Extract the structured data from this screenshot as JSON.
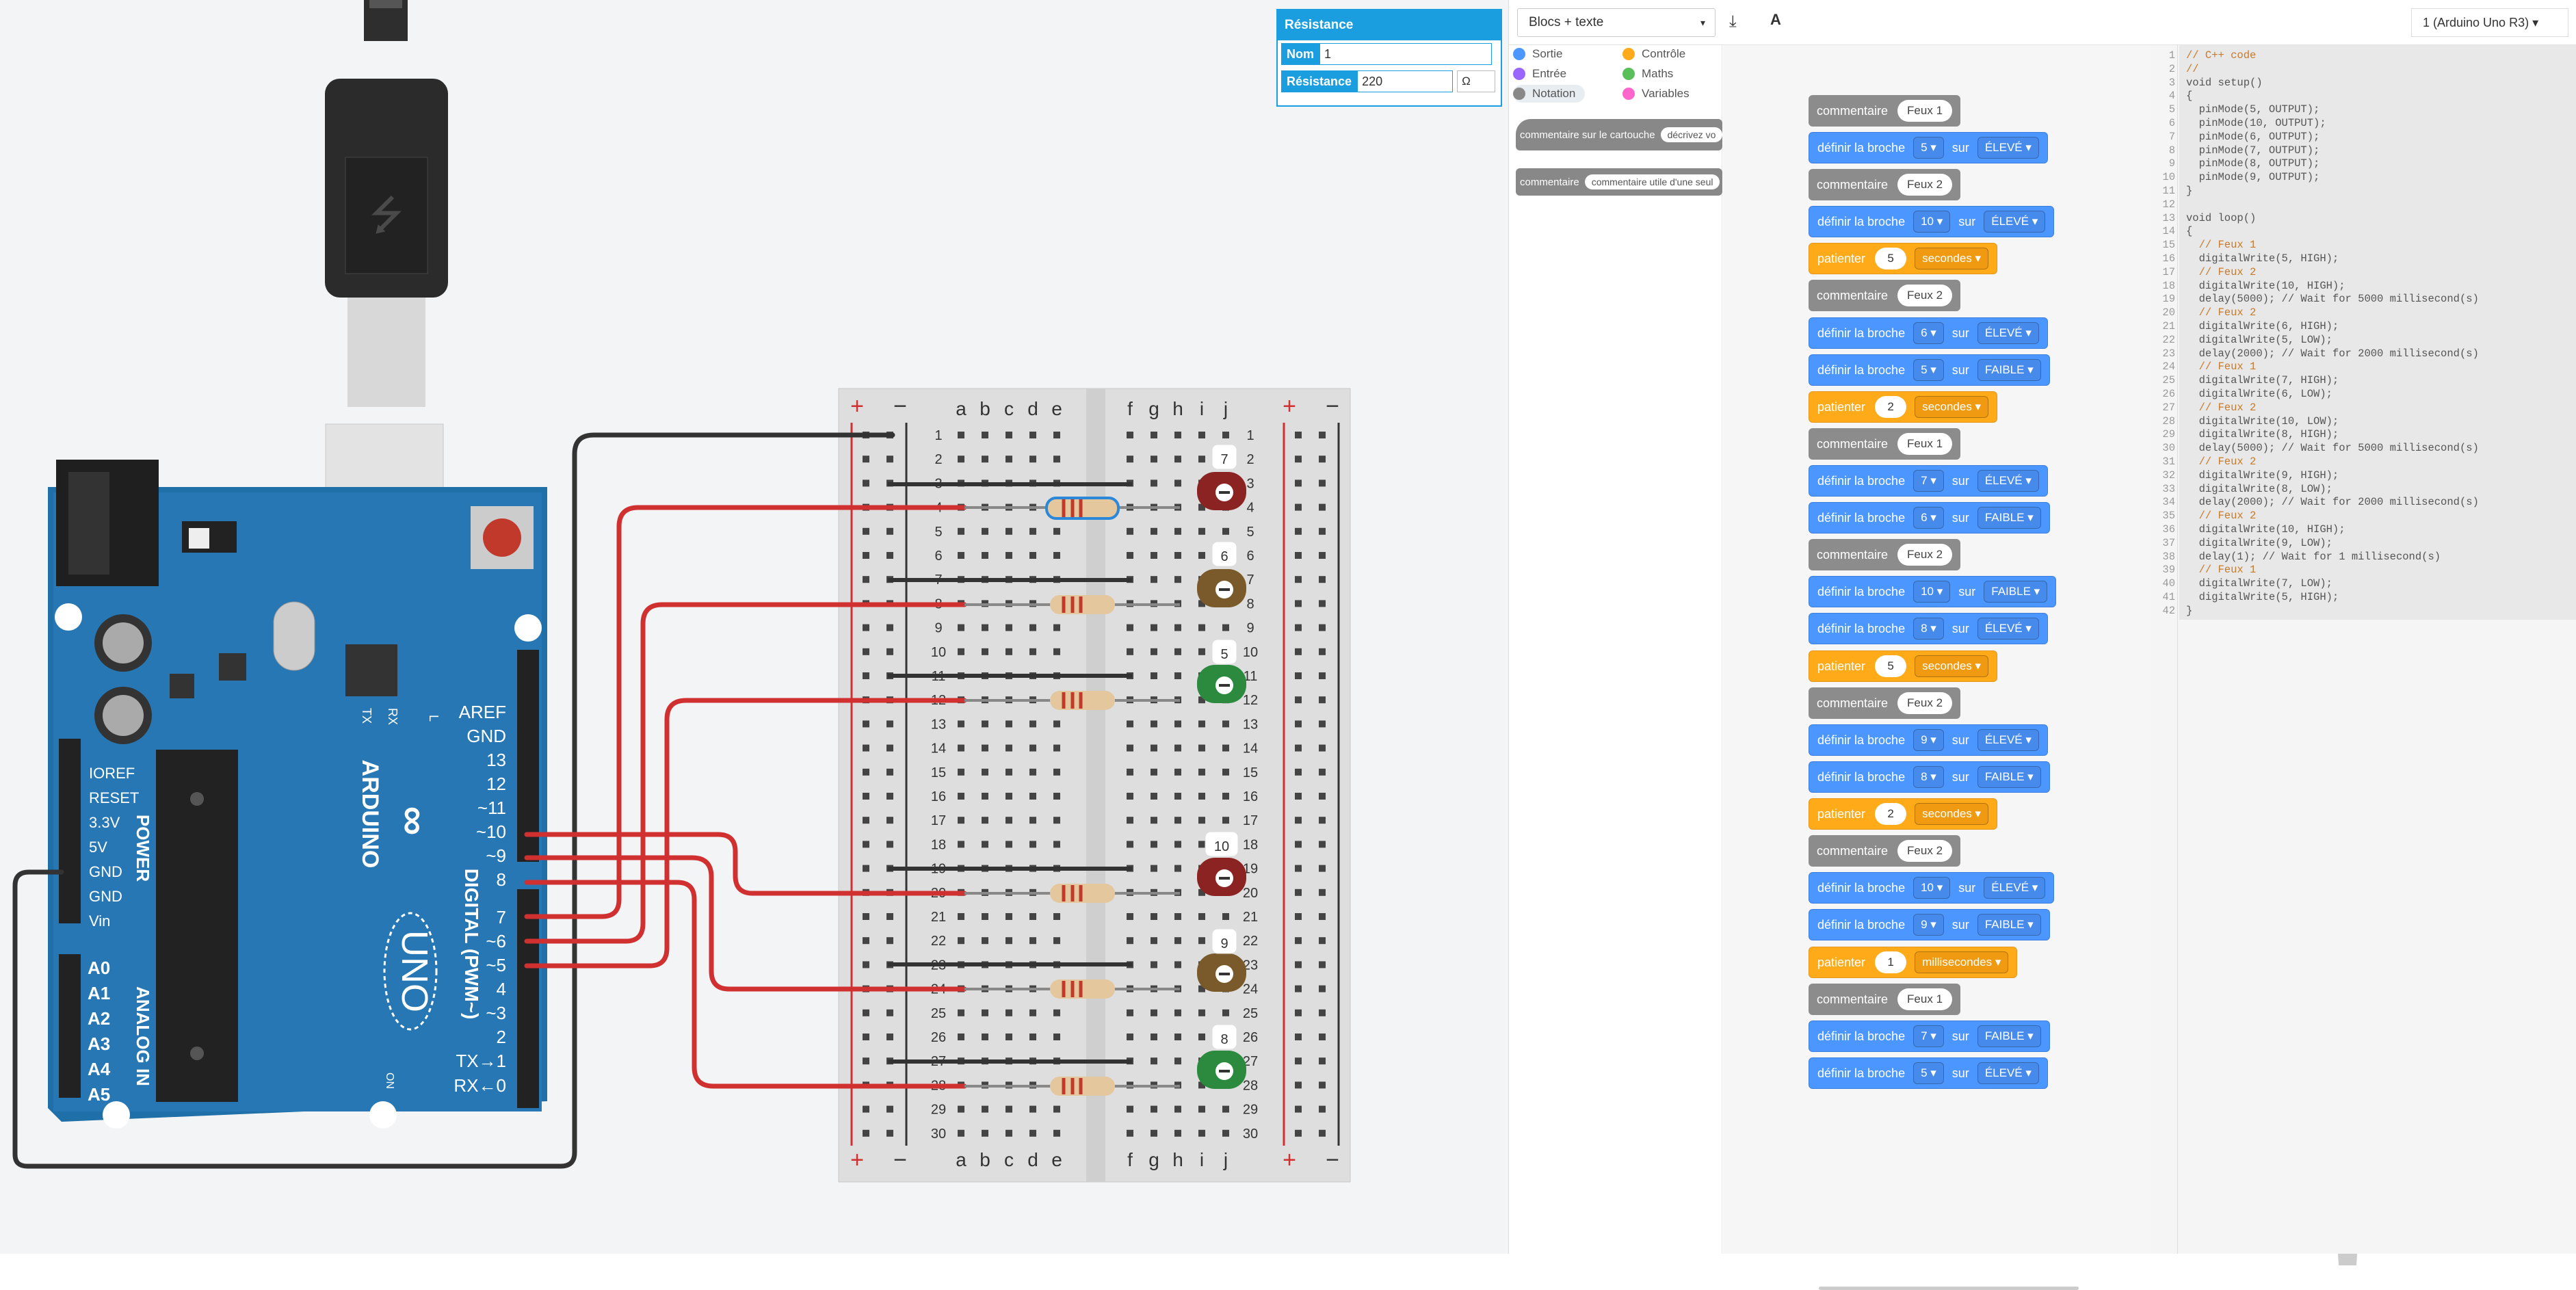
{
  "props": {
    "title": "Résistance",
    "name_label": "Nom",
    "name_value": "1",
    "res_label": "Résistance",
    "res_value": "220",
    "unit": "Ω"
  },
  "board": {
    "brand": "ARDUINO",
    "model": "UNO",
    "power": "POWER",
    "analog": "ANALOG IN",
    "digital": "DIGITAL (PWM~)",
    "on": "ON",
    "tx": "TX",
    "rx": "RX",
    "l": "L",
    "left_pins": [
      "IOREF",
      "RESET",
      "3.3V",
      "5V",
      "GND",
      "GND",
      "Vin"
    ],
    "analog_pins": [
      "A0",
      "A1",
      "A2",
      "A3",
      "A4",
      "A5"
    ],
    "right_pins": [
      "AREF",
      "GND",
      "13",
      "12",
      "~11",
      "~10",
      "~9",
      "8",
      "7",
      "~6",
      "~5",
      "4",
      "~3",
      "2",
      "TX→1",
      "RX←0"
    ]
  },
  "breadboard": {
    "cols_left": [
      "a",
      "b",
      "c",
      "d",
      "e"
    ],
    "cols_right": [
      "f",
      "g",
      "h",
      "i",
      "j"
    ],
    "rows": 30,
    "plus": "+",
    "minus": "−"
  },
  "led_labels": [
    "7",
    "6",
    "5",
    "10",
    "9",
    "8"
  ],
  "toolbar": {
    "mode": "Blocs + texte",
    "mode_chevron": "▾",
    "download_icon": "⤓",
    "font_icon": "A",
    "device": "1 (Arduino Uno R3)",
    "device_chevron": "▾"
  },
  "palette": {
    "categories": [
      {
        "label": "Sortie",
        "color": "#4c97ff"
      },
      {
        "label": "Contrôle",
        "color": "#ffab19"
      },
      {
        "label": "Entrée",
        "color": "#9966ff"
      },
      {
        "label": "Maths",
        "color": "#59c059"
      },
      {
        "label": "Notation",
        "color": "#888888"
      },
      {
        "label": "Variables",
        "color": "#ff66cc"
      }
    ],
    "block1_label": "commentaire sur le cartouche",
    "block1_pill": "décrivez vo",
    "block2_label": "commentaire",
    "block2_pill": "commentaire utile d'une seul"
  },
  "blocks": [
    {
      "type": "comment",
      "label": "commentaire",
      "v": "Feux 1"
    },
    {
      "type": "set",
      "label": "définir la broche",
      "pin": "5 ▾",
      "sur": "sur",
      "state": "ÉLEVÉ ▾"
    },
    {
      "type": "comment",
      "label": "commentaire",
      "v": "Feux 2"
    },
    {
      "type": "set",
      "label": "définir la broche",
      "pin": "10 ▾",
      "sur": "sur",
      "state": "ÉLEVÉ ▾"
    },
    {
      "type": "wait",
      "label": "patienter",
      "n": "5",
      "unit": "secondes ▾"
    },
    {
      "type": "comment",
      "label": "commentaire",
      "v": "Feux 2"
    },
    {
      "type": "set",
      "label": "définir la broche",
      "pin": "6 ▾",
      "sur": "sur",
      "state": "ÉLEVÉ ▾"
    },
    {
      "type": "set",
      "label": "définir la broche",
      "pin": "5 ▾",
      "sur": "sur",
      "state": "FAIBLE ▾"
    },
    {
      "type": "wait",
      "label": "patienter",
      "n": "2",
      "unit": "secondes ▾"
    },
    {
      "type": "comment",
      "label": "commentaire",
      "v": "Feux 1"
    },
    {
      "type": "set",
      "label": "définir la broche",
      "pin": "7 ▾",
      "sur": "sur",
      "state": "ÉLEVÉ ▾"
    },
    {
      "type": "set",
      "label": "définir la broche",
      "pin": "6 ▾",
      "sur": "sur",
      "state": "FAIBLE ▾"
    },
    {
      "type": "comment",
      "label": "commentaire",
      "v": "Feux 2"
    },
    {
      "type": "set",
      "label": "définir la broche",
      "pin": "10 ▾",
      "sur": "sur",
      "state": "FAIBLE ▾"
    },
    {
      "type": "set",
      "label": "définir la broche",
      "pin": "8 ▾",
      "sur": "sur",
      "state": "ÉLEVÉ ▾"
    },
    {
      "type": "wait",
      "label": "patienter",
      "n": "5",
      "unit": "secondes ▾"
    },
    {
      "type": "comment",
      "label": "commentaire",
      "v": "Feux 2"
    },
    {
      "type": "set",
      "label": "définir la broche",
      "pin": "9 ▾",
      "sur": "sur",
      "state": "ÉLEVÉ ▾"
    },
    {
      "type": "set",
      "label": "définir la broche",
      "pin": "8 ▾",
      "sur": "sur",
      "state": "FAIBLE ▾"
    },
    {
      "type": "wait",
      "label": "patienter",
      "n": "2",
      "unit": "secondes ▾"
    },
    {
      "type": "comment",
      "label": "commentaire",
      "v": "Feux 2"
    },
    {
      "type": "set",
      "label": "définir la broche",
      "pin": "10 ▾",
      "sur": "sur",
      "state": "ÉLEVÉ ▾"
    },
    {
      "type": "set",
      "label": "définir la broche",
      "pin": "9 ▾",
      "sur": "sur",
      "state": "FAIBLE ▾"
    },
    {
      "type": "wait",
      "label": "patienter",
      "n": "1",
      "unit": "millisecondes ▾"
    },
    {
      "type": "comment",
      "label": "commentaire",
      "v": "Feux 1"
    },
    {
      "type": "set",
      "label": "définir la broche",
      "pin": "7 ▾",
      "sur": "sur",
      "state": "FAIBLE ▾"
    },
    {
      "type": "set",
      "label": "définir la broche",
      "pin": "5 ▾",
      "sur": "sur",
      "state": "ÉLEVÉ ▾"
    }
  ],
  "zoom": {
    "in": "⊕",
    "out": "⊖",
    "fit": "="
  },
  "code": [
    "// C++ code",
    "//",
    "void setup()",
    "{",
    "  pinMode(5, OUTPUT);",
    "  pinMode(10, OUTPUT);",
    "  pinMode(6, OUTPUT);",
    "  pinMode(7, OUTPUT);",
    "  pinMode(8, OUTPUT);",
    "  pinMode(9, OUTPUT);",
    "}",
    "",
    "void loop()",
    "{",
    "  // Feux 1",
    "  digitalWrite(5, HIGH);",
    "  // Feux 2",
    "  digitalWrite(10, HIGH);",
    "  delay(5000); // Wait for 5000 millisecond(s)",
    "  // Feux 2",
    "  digitalWrite(6, HIGH);",
    "  digitalWrite(5, LOW);",
    "  delay(2000); // Wait for 2000 millisecond(s)",
    "  // Feux 1",
    "  digitalWrite(7, HIGH);",
    "  digitalWrite(6, LOW);",
    "  // Feux 2",
    "  digitalWrite(10, LOW);",
    "  digitalWrite(8, HIGH);",
    "  delay(5000); // Wait for 5000 millisecond(s)",
    "  // Feux 2",
    "  digitalWrite(9, HIGH);",
    "  digitalWrite(8, LOW);",
    "  delay(2000); // Wait for 2000 millisecond(s)",
    "  // Feux 2",
    "  digitalWrite(10, HIGH);",
    "  digitalWrite(9, LOW);",
    "  delay(1); // Wait for 1 millisecond(s)",
    "  // Feux 1",
    "  digitalWrite(7, LOW);",
    "  digitalWrite(5, HIGH);",
    "}"
  ]
}
